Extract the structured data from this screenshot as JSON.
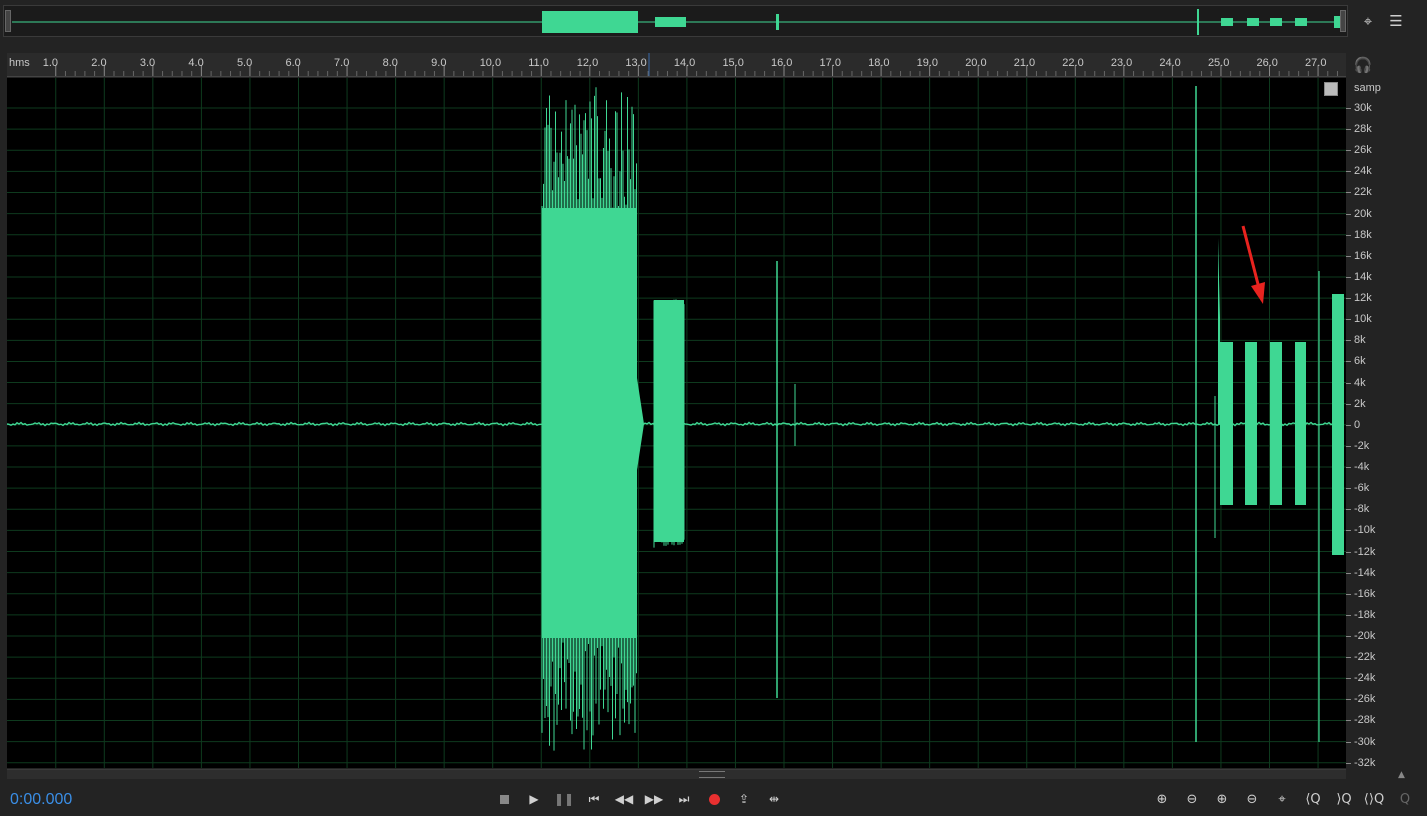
{
  "timeline": {
    "unit_label": "hms",
    "ticks": [
      "1.0",
      "2.0",
      "3.0",
      "4.0",
      "5.0",
      "6.0",
      "7.0",
      "8.0",
      "9.0",
      "10.0",
      "11.0",
      "12.0",
      "13.0",
      "14.0",
      "15.0",
      "16.0",
      "17.0",
      "18.0",
      "19.0",
      "20.0",
      "21.0",
      "22.0",
      "23.0",
      "24.0",
      "25.0",
      "26.0",
      "27.0"
    ]
  },
  "amplitude_ruler": {
    "unit_label": "samp",
    "labels": [
      "30k",
      "28k",
      "26k",
      "24k",
      "22k",
      "20k",
      "18k",
      "16k",
      "14k",
      "12k",
      "10k",
      "8k",
      "6k",
      "4k",
      "2k",
      "0",
      "-2k",
      "-4k",
      "-6k",
      "-8k",
      "-10k",
      "-12k",
      "-14k",
      "-16k",
      "-18k",
      "-20k",
      "-22k",
      "-24k",
      "-26k",
      "-28k",
      "-30k",
      "-32k"
    ]
  },
  "transport": {
    "timecode": "0:00.000",
    "buttons": [
      "stop-icon",
      "play-icon",
      "pause-icon",
      "skip-to-start-icon",
      "rewind-icon",
      "fast-forward-icon",
      "skip-to-end-icon",
      "record-icon",
      "play-loop-icon",
      "skip-selection-icon"
    ]
  },
  "zoom_tools": [
    "zoom-in-amplitude-icon",
    "zoom-out-amplitude-icon",
    "zoom-in-time-icon",
    "zoom-out-time-icon",
    "zoom-full-icon",
    "zoom-in-left-icon",
    "zoom-in-right-icon",
    "zoom-selection-icon",
    "zoom-reset-icon"
  ],
  "colors": {
    "waveform": "#3fd793",
    "background": "#000000",
    "grid": "#0e3a1e",
    "timecode": "#3a8ee6",
    "annotation_arrow": "#e8231f",
    "record": "#e83030"
  }
}
